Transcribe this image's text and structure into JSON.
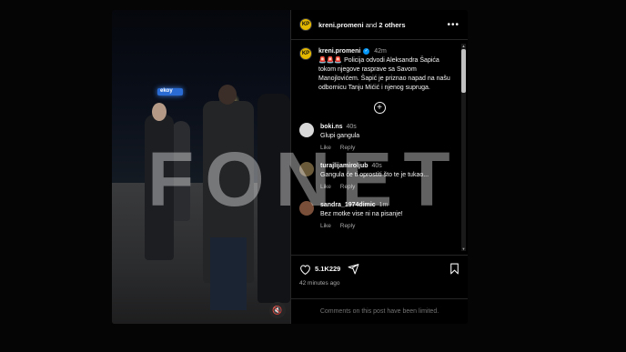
{
  "header": {
    "author": "kreni.promeni",
    "and_text": "and",
    "others_text": "2 others",
    "more_icon": "more-horizontal-icon"
  },
  "caption": {
    "username": "kreni.promeni",
    "verified": "✓",
    "time": "42m",
    "sirens": "🚨🚨🚨",
    "text": "Policija odvodi Aleksandra Šapića tokom njegove rasprave sa Savom Manojlovićem. Šapić je priznao napad na našu odbornicu Tanju Mićić i njenog supruga."
  },
  "comments": [
    {
      "username": "boki.ns",
      "time": "40s",
      "text": "Glupi gangula",
      "like": "Like",
      "reply": "Reply",
      "avatar_color": "#d9d9d9"
    },
    {
      "username": "turajlijamiroljub",
      "time": "40s",
      "text": "Gangula će ti oprostiti što te je tukao...",
      "like": "Like",
      "reply": "Reply",
      "avatar_color": "#6b5a3a"
    },
    {
      "username": "sandra_1974dimic",
      "time": "1m",
      "text": "Bez motke vise ni na pisanje!",
      "like": "Like",
      "reply": "Reply",
      "avatar_color": "#7a4f3a"
    }
  ],
  "actions": {
    "likes": "5.1K229",
    "time_ago": "42 minutes ago",
    "comments_limited": "Comments on this post have been limited."
  },
  "media": {
    "store_sign": "ekoy",
    "mute_icon": "🔇"
  },
  "watermark": "FONET",
  "colors": {
    "background": "#000000",
    "border": "#262626",
    "secondary_text": "#a8a8a8",
    "verified": "#0095f6"
  }
}
